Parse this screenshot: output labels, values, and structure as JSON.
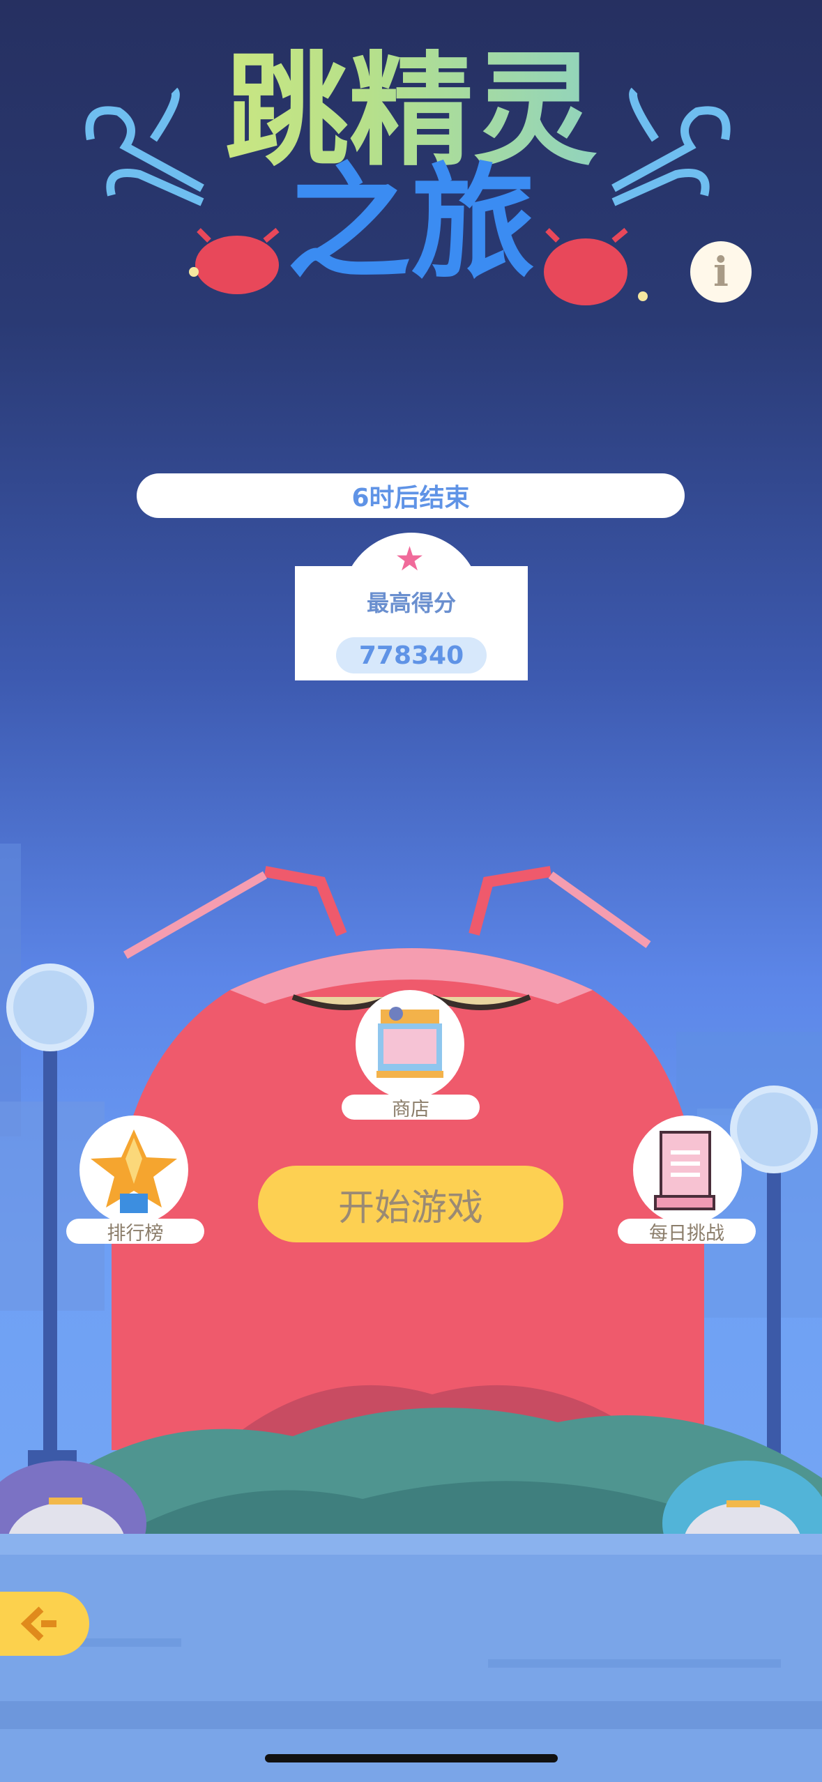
{
  "title": {
    "line1": "跳精灵",
    "line2": "之旅"
  },
  "info_button": {
    "glyph": "i"
  },
  "timer": {
    "text": "6时后结束"
  },
  "best_score": {
    "label": "最高得分",
    "value": "778340",
    "icon": "star-icon"
  },
  "menu": {
    "shop": {
      "label": "商店",
      "icon": "shop-stall-icon"
    },
    "leaderboard": {
      "label": "排行榜",
      "icon": "star-trophy-icon"
    },
    "daily": {
      "label": "每日挑战",
      "icon": "scroll-icon"
    }
  },
  "start_button": {
    "label": "开始游戏"
  },
  "back_button": {
    "icon": "back-arrow-icon"
  },
  "colors": {
    "accent_blue": "#5f93e6",
    "start_yellow": "#fdd052",
    "monster_red": "#ef5a6c",
    "title_blue": "#3b8cf2"
  }
}
